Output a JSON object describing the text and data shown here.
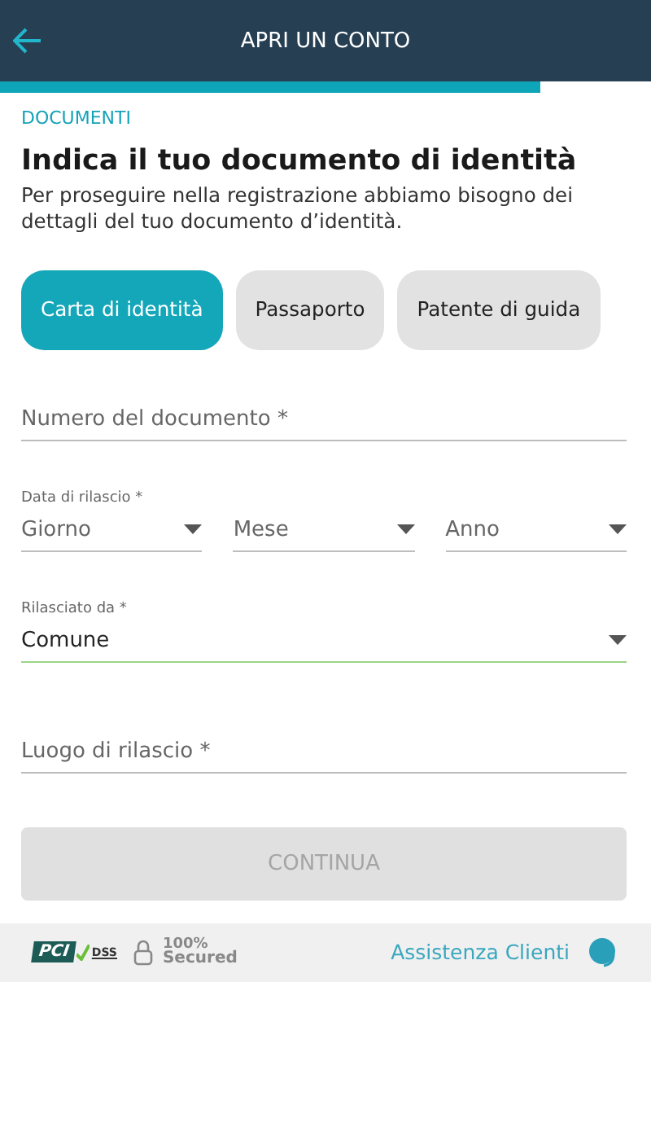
{
  "header": {
    "title": "APRI UN CONTO"
  },
  "progress": {
    "level": 0.83
  },
  "section": "DOCUMENTI",
  "heading": "Indica il tuo documento di identità",
  "intro": "Per proseguire nella registrazione abbiamo bisogno dei dettagli del tuo documento d’identità.",
  "document_types": [
    {
      "label": "Carta di identità",
      "selected": true
    },
    {
      "label": "Passaporto",
      "selected": false
    },
    {
      "label": "Patente di guida",
      "selected": false
    }
  ],
  "document_number": {
    "placeholder": "Numero del documento *"
  },
  "issue_date": {
    "label": "Data di rilascio *",
    "parts": [
      {
        "placeholder": "Giorno"
      },
      {
        "placeholder": "Mese"
      },
      {
        "placeholder": "Anno"
      }
    ]
  },
  "issued_by": {
    "label": "Rilasciato da *",
    "value": "Comune",
    "focused": true
  },
  "issue_place": {
    "placeholder": "Luogo di rilascio *"
  },
  "continue_button": {
    "label": "CONTINUA",
    "disabled": true
  },
  "footer": {
    "pci_badge": {
      "mark": "PCI",
      "label": "DSS"
    },
    "secured_badge": {
      "line1": "100%",
      "line2": "Secured"
    },
    "support_link": "Assistenza Clienti"
  }
}
